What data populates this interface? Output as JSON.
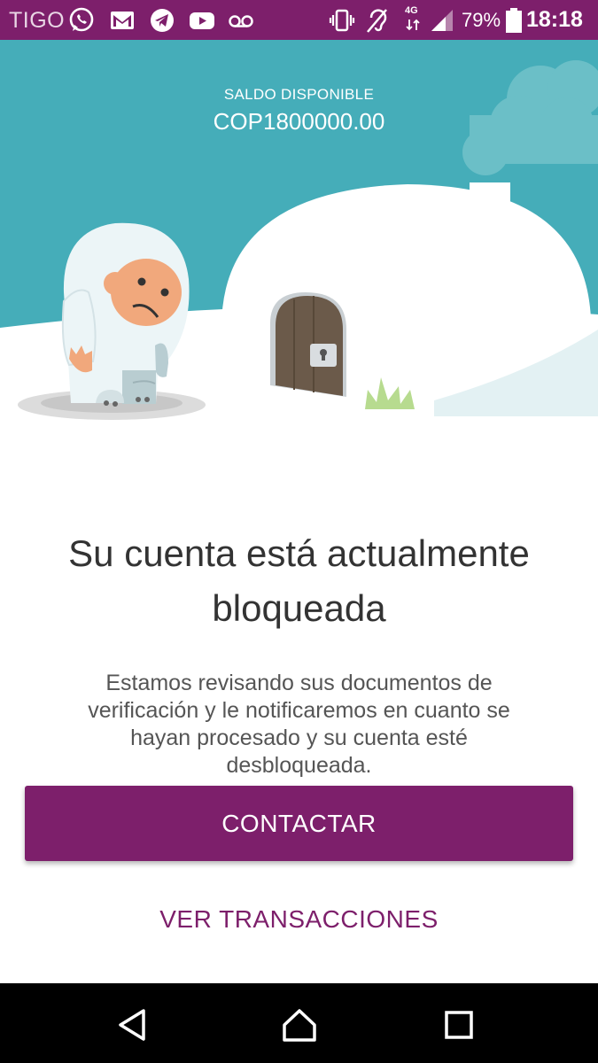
{
  "status_bar": {
    "carrier": "TIGO",
    "notification_icons": [
      "whatsapp-icon",
      "gmail-icon",
      "telegram-icon",
      "youtube-icon",
      "voicemail-icon"
    ],
    "system_icons": [
      "vibrate-icon",
      "hearing-aid-icon",
      "4g-icon",
      "signal-icon",
      "battery-icon"
    ],
    "network_type": "4G",
    "battery": "79%",
    "time": "18:18"
  },
  "balance": {
    "label": "SALDO DISPONIBLE",
    "value": "COP1800000.00"
  },
  "message": {
    "title": "Su cuenta está actualmente bloqueada",
    "body": "Estamos revisando sus documentos de verificación y le notificaremos en cuanto se hayan procesado y su cuenta esté desbloqueada."
  },
  "actions": {
    "contact_label": "CONTACTAR",
    "transactions_label": "VER TRANSACCIONES"
  },
  "nav_bar": {
    "icons": [
      "back-icon",
      "home-icon",
      "recents-icon"
    ]
  },
  "colors": {
    "brand_purple": "#7d1f6b",
    "sky_teal": "#45adb9",
    "smoke": "#6bbfc7",
    "snow": "#ffffff",
    "door_brown": "#6b5a4a",
    "yeti_face": "#f1a87c"
  }
}
